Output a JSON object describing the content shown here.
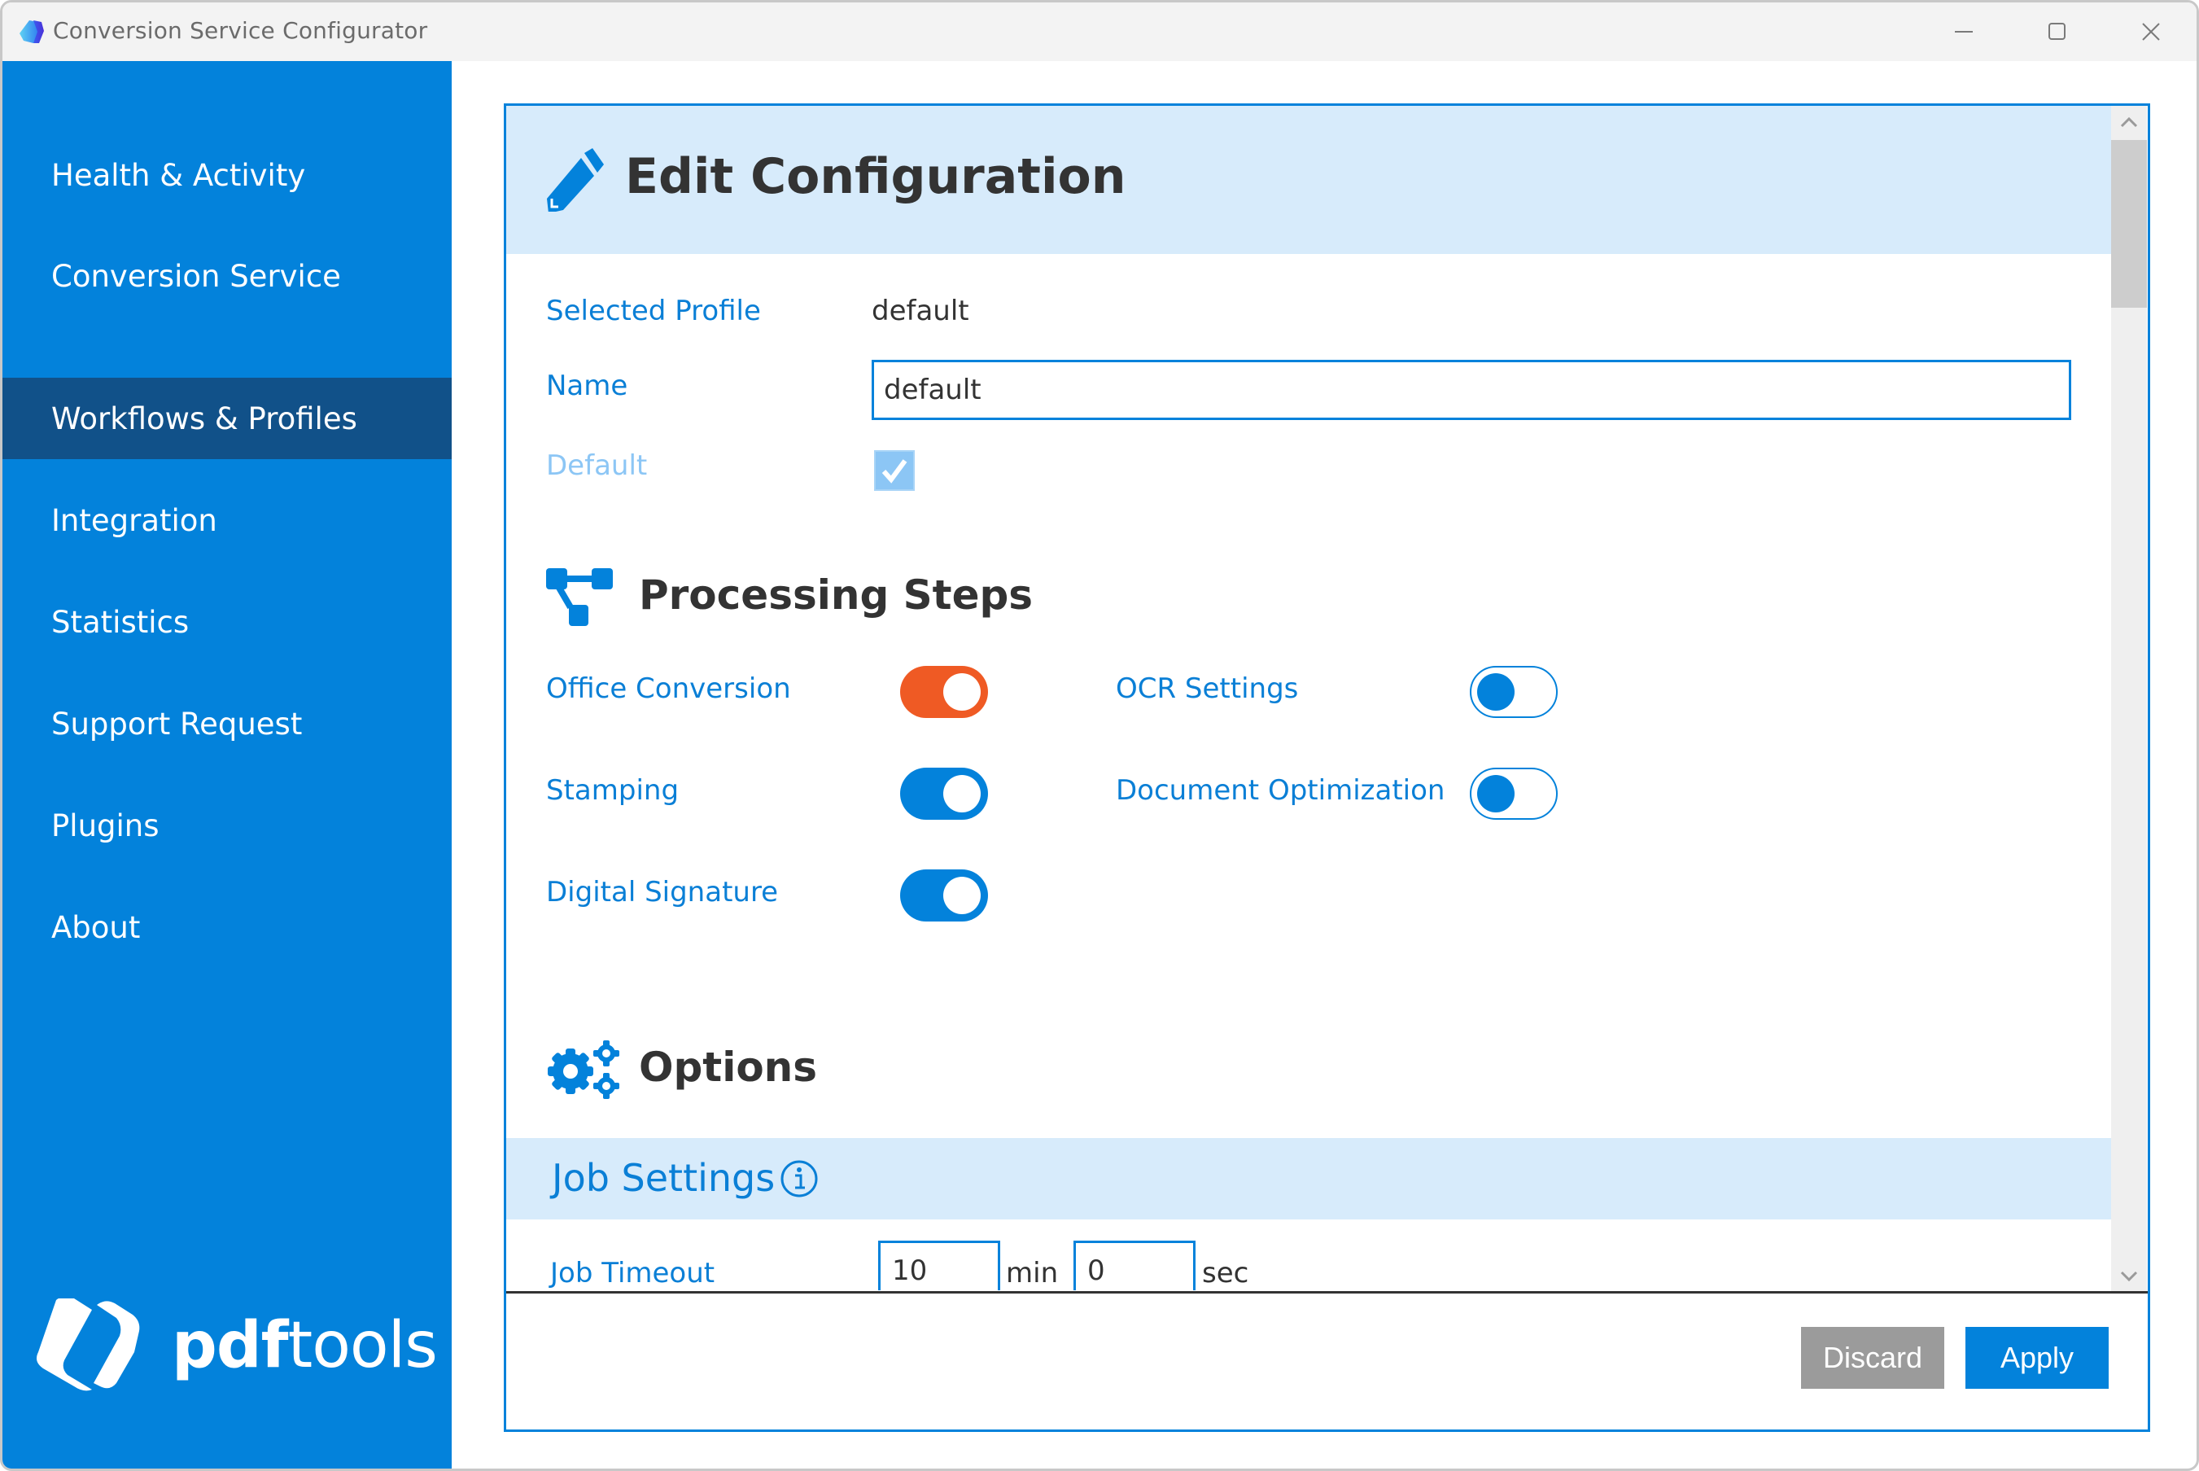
{
  "window": {
    "title": "Conversion Service Configurator",
    "controls": {
      "minimize": "minimize-icon",
      "maximize": "maximize-icon",
      "close": "close-icon"
    }
  },
  "sidebar": {
    "items": [
      {
        "label": "Health & Activity",
        "active": false
      },
      {
        "label": "Conversion Service",
        "active": false
      },
      {
        "label": "Workflows & Profiles",
        "active": true
      },
      {
        "label": "Integration",
        "active": false
      },
      {
        "label": "Statistics",
        "active": false
      },
      {
        "label": "Support Request",
        "active": false
      },
      {
        "label": "Plugins",
        "active": false
      },
      {
        "label": "About",
        "active": false
      }
    ],
    "brand": {
      "bold": "pdf",
      "regular": "tools"
    }
  },
  "main": {
    "title": "Edit Configuration",
    "selected_profile_label": "Selected Profile",
    "selected_profile_value": "default",
    "name_label": "Name",
    "name_value": "default",
    "default_label": "Default",
    "default_checked": true,
    "processing_steps": {
      "title": "Processing Steps",
      "steps": [
        {
          "label": "Office Conversion",
          "enabled": true,
          "accent": "#EF5A24"
        },
        {
          "label": "Stamping",
          "enabled": true,
          "accent": "#0382DB"
        },
        {
          "label": "Digital Signature",
          "enabled": true,
          "accent": "#0382DB"
        },
        {
          "label": "OCR Settings",
          "enabled": false,
          "accent": "#0382DB"
        },
        {
          "label": "Document Optimization",
          "enabled": false,
          "accent": "#0382DB"
        }
      ]
    },
    "options": {
      "title": "Options",
      "job_settings": {
        "title": "Job Settings",
        "job_timeout_label": "Job Timeout",
        "minutes_value": "10",
        "minutes_unit": "min",
        "seconds_value": "0",
        "seconds_unit": "sec"
      }
    }
  },
  "footer": {
    "discard_label": "Discard",
    "apply_label": "Apply"
  },
  "colors": {
    "brand_blue": "#0382DB",
    "sidebar_active": "#115189",
    "header_band": "#D7EBFB",
    "accent_orange": "#EF5A24",
    "discard_gray": "#9B9B9B"
  }
}
